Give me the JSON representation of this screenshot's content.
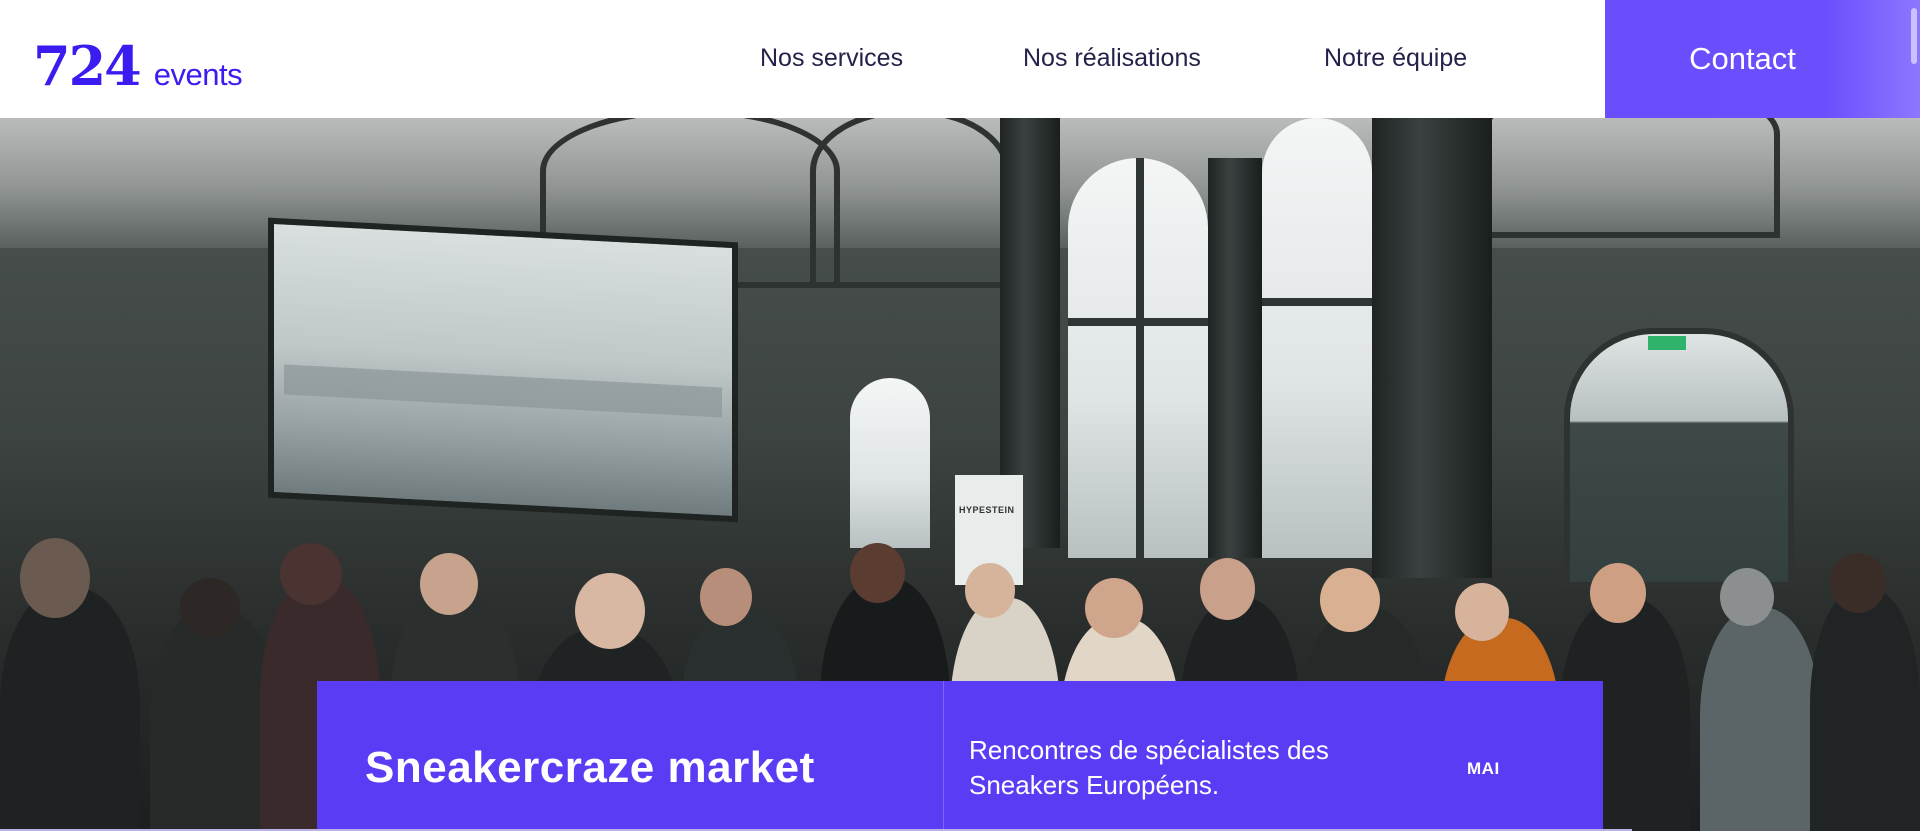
{
  "header": {
    "logo": {
      "number": "724",
      "word": "events"
    },
    "nav": [
      {
        "label": "Nos services"
      },
      {
        "label": "Nos réalisations"
      },
      {
        "label": "Notre équipe"
      }
    ],
    "contact_label": "Contact"
  },
  "hero": {
    "banner_text": "HYPESTEIN"
  },
  "event": {
    "title": "Sneakercraze market",
    "description": "Rencontres de spécialistes des Sneakers Européens.",
    "month": "MAI"
  },
  "colors": {
    "brand": "#3a1cf0",
    "accent": "#5b3cf5",
    "contact_bg": "#6a4dfd"
  }
}
